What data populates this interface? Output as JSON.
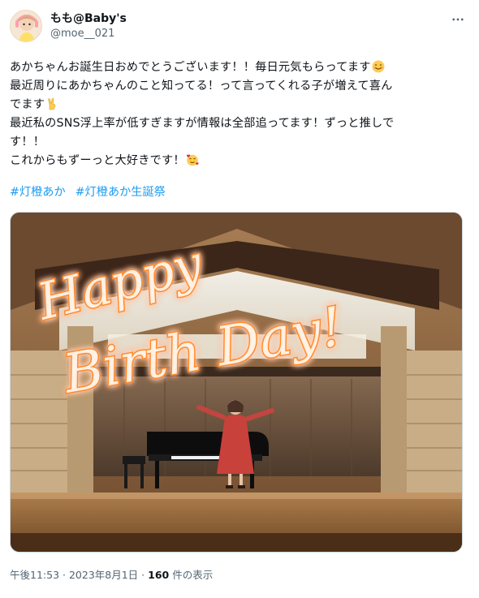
{
  "author": {
    "display_name": "もも@Baby's",
    "handle": "@moe__021"
  },
  "body": {
    "line1": "あかちゃんお誕生日おめでとうございます！！毎日元気もらってます",
    "line2": "最近周りにあかちゃんのこと知ってる！って言ってくれる子が増えて喜ん",
    "line3": "でます",
    "line4": "最近私のSNS浮上率が低すぎますが情報は全部追ってます！ずっと推しで",
    "line5": "す！！",
    "line6": "これからもずーっと大好きです！"
  },
  "hashtags": [
    "#灯橙あか",
    "#灯橙あか生誕祭"
  ],
  "media": {
    "overlay_text_line1": "Happy",
    "overlay_text_line2": "Birth Day!"
  },
  "meta": {
    "time": "午後11:53",
    "date": "2023年8月1日",
    "views_count": "160",
    "views_label": "件の表示"
  },
  "icons": {
    "more": "more-dots-icon",
    "emoji1": "smiling-face-emoji",
    "emoji2": "victory-hand-emoji",
    "emoji3": "smiling-face-with-hearts-emoji"
  },
  "colors": {
    "hashtag": "#1d9bf0",
    "secondary_text": "#536471",
    "primary_text": "#0f1419"
  }
}
